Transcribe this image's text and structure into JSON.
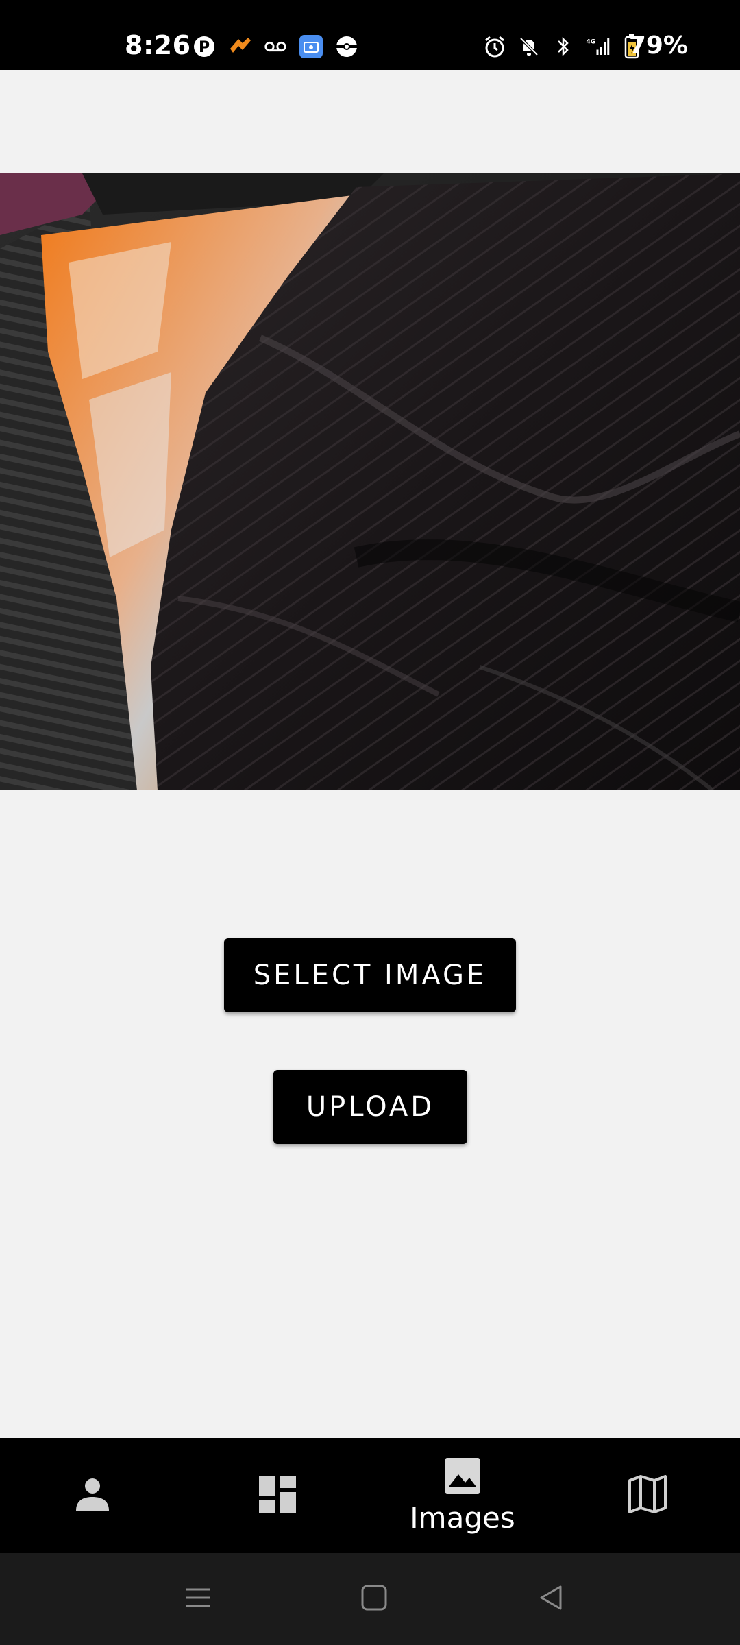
{
  "status_bar": {
    "time": "8:26",
    "battery_percent": "79%",
    "left_icons": [
      "pinterest-icon",
      "app-notification-icon",
      "voicemail-icon",
      "radio-app-icon",
      "pokeball-icon"
    ],
    "right_icons": [
      "alarm-icon",
      "bell-muted-icon",
      "bluetooth-icon",
      "signal-4g-icon",
      "battery-charging-icon"
    ]
  },
  "photo": {
    "description_icon": "photo-preview"
  },
  "buttons": {
    "select_image": "SELECT IMAGE",
    "upload": "UPLOAD"
  },
  "bottom_nav": {
    "items": [
      {
        "icon": "person-icon",
        "label": ""
      },
      {
        "icon": "dashboard-icon",
        "label": ""
      },
      {
        "icon": "image-icon",
        "label": "Images",
        "active": true
      },
      {
        "icon": "map-icon",
        "label": ""
      }
    ]
  },
  "system_nav": {
    "icons": [
      "recent-apps-icon",
      "home-icon",
      "back-icon"
    ]
  },
  "colors": {
    "status_bar_bg": "#000000",
    "content_bg": "#f2f2f2",
    "button_bg": "#000000",
    "button_text": "#ffffff",
    "bottom_nav_bg": "#000000",
    "system_nav_bg": "#1b1b1b"
  }
}
